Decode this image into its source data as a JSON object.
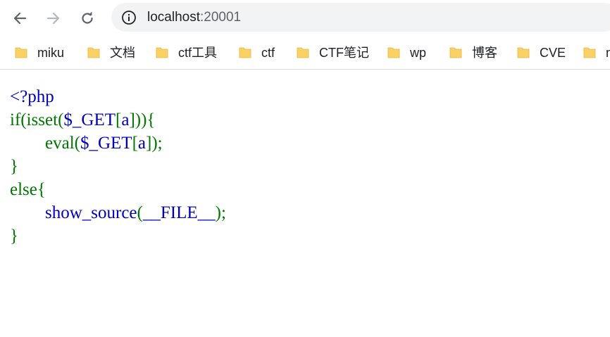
{
  "browser": {
    "back_icon": "arrow-left-icon",
    "forward_icon": "arrow-right-icon",
    "reload_icon": "reload-icon",
    "info_icon": "info-circle-icon",
    "url_host": "localhost",
    "url_port": ":20001"
  },
  "bookmarks": [
    {
      "label": "miku",
      "icon": "folder-icon"
    },
    {
      "label": "文档",
      "icon": "folder-icon"
    },
    {
      "label": "ctf工具",
      "icon": "folder-icon"
    },
    {
      "label": "ctf",
      "icon": "folder-icon"
    },
    {
      "label": "CTF笔记",
      "icon": "folder-icon"
    },
    {
      "label": "wp",
      "icon": "folder-icon"
    },
    {
      "label": "博客",
      "icon": "folder-icon"
    },
    {
      "label": "CVE",
      "icon": "folder-icon"
    },
    {
      "label": "m",
      "icon": "folder-icon"
    }
  ],
  "source": {
    "colors": {
      "default": "#0000BB",
      "keyword": "#007700",
      "folder": "#FAD165"
    },
    "lines": [
      [
        {
          "t": "<?php",
          "c": "default"
        }
      ],
      [
        {
          "t": "if",
          "c": "keyword"
        },
        {
          "t": "(",
          "c": "keyword"
        },
        {
          "t": "isset",
          "c": "keyword"
        },
        {
          "t": "(",
          "c": "keyword"
        },
        {
          "t": "$_GET",
          "c": "default"
        },
        {
          "t": "[",
          "c": "keyword"
        },
        {
          "t": "a",
          "c": "default"
        },
        {
          "t": "])){",
          "c": "keyword"
        }
      ],
      [
        {
          "t": "        ",
          "c": "default"
        },
        {
          "t": "eval",
          "c": "keyword"
        },
        {
          "t": "(",
          "c": "keyword"
        },
        {
          "t": "$_GET",
          "c": "default"
        },
        {
          "t": "[",
          "c": "keyword"
        },
        {
          "t": "a",
          "c": "default"
        },
        {
          "t": "]);",
          "c": "keyword"
        }
      ],
      [
        {
          "t": "}",
          "c": "keyword"
        }
      ],
      [
        {
          "t": "else{",
          "c": "keyword"
        }
      ],
      [
        {
          "t": "        ",
          "c": "default"
        },
        {
          "t": "show_source",
          "c": "default"
        },
        {
          "t": "(",
          "c": "keyword"
        },
        {
          "t": "__FILE__",
          "c": "default"
        },
        {
          "t": ");",
          "c": "keyword"
        }
      ],
      [
        {
          "t": "}",
          "c": "keyword"
        }
      ]
    ]
  }
}
